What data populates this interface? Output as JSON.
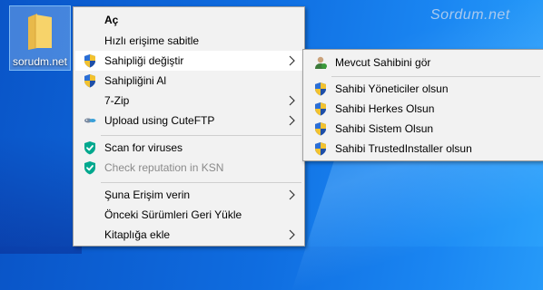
{
  "watermark": "Sordum.net",
  "desktop_icon": {
    "label": "sorudm.net"
  },
  "context_menu": {
    "items": [
      {
        "label": "Aç",
        "bold": true
      },
      {
        "label": "Hızlı erişime sabitle"
      },
      {
        "label": "Sahipliği değiştir"
      },
      {
        "label": "Sahipliğini Al"
      },
      {
        "label": "7-Zip"
      },
      {
        "label": "Upload using CuteFTP"
      },
      {
        "label": "Scan for viruses"
      },
      {
        "label": "Check reputation in KSN"
      },
      {
        "label": "Şuna Erişim verin"
      },
      {
        "label": "Önceki Sürümleri Geri Yükle"
      },
      {
        "label": "Kitaplığa ekle"
      }
    ]
  },
  "submenu": {
    "items": [
      {
        "label": "Mevcut Sahibini gör"
      },
      {
        "label": "Sahibi Yöneticiler olsun"
      },
      {
        "label": "Sahibi Herkes Olsun"
      },
      {
        "label": "Sahibi Sistem Olsun"
      },
      {
        "label": "Sahibi TrustedInstaller olsun"
      }
    ]
  },
  "colors": {
    "desktop": "#0f6de0",
    "menu_bg": "#f2f2f2",
    "highlight": "#ffffff",
    "kaspersky_green": "#00a88e",
    "disabled_text": "#8a8a8a"
  },
  "icons": {
    "uac_shield": "uac-shield-icon",
    "kaspersky": "kaspersky-shield-icon",
    "cuteftp": "cuteftp-icon",
    "user": "user-icon",
    "folder": "folder-icon",
    "submenu_arrow": "chevron-right-icon"
  }
}
